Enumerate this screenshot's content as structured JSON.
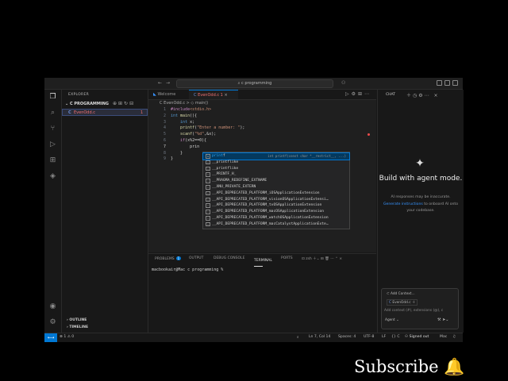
{
  "titlebar": {
    "search": "c programming"
  },
  "explorer": {
    "title": "EXPLORER",
    "folder": "C PROGRAMMING",
    "file_icon": "C",
    "file": "EvenOdd.c",
    "file_badge": "1",
    "sections": [
      "OUTLINE",
      "TIMELINE"
    ]
  },
  "editor": {
    "tabs": [
      {
        "label": "Welcome"
      },
      {
        "label": "EvenOdd.c 1"
      }
    ],
    "breadcrumb": "C EvenOdd.c  >  ◇ main()",
    "lines": [
      {
        "n": "1",
        "html": "<span class='pp'>#include</span><span class='st'>&lt;stdio.h&gt;</span>"
      },
      {
        "n": "2",
        "html": "<span class='kw'>int</span> <span class='fn'>main</span>(){"
      },
      {
        "n": "3",
        "html": "    <span class='kw'>int</span> x;"
      },
      {
        "n": "4",
        "html": "    <span class='fn'>printf</span>(<span class='st'>\"Enter a number: \"</span>);"
      },
      {
        "n": "5",
        "html": "    <span class='fn'>scanf</span>(<span class='st'>\"%d\"</span>,&amp;x);"
      },
      {
        "n": "6",
        "html": "    <span class='pp'>if</span>(x%2==0){"
      },
      {
        "n": "7",
        "html": "        prin"
      },
      {
        "n": "8",
        "html": "    }"
      },
      {
        "n": "9",
        "html": "}"
      }
    ]
  },
  "suggest": {
    "items": [
      {
        "label": "printf",
        "detail": "int printf(const char *__restrict__, ...)"
      },
      {
        "label": "__printflike",
        "detail": ""
      },
      {
        "label": "__printflike",
        "detail": ""
      },
      {
        "label": "__PRINTF_H_",
        "detail": ""
      },
      {
        "label": "__PRAGMA_REDEFINE_EXTNAME",
        "detail": ""
      },
      {
        "label": "__XNU_PRIVATE_EXTERN",
        "detail": ""
      },
      {
        "label": "__API_DEPRECATED_PLATFORM_iOSApplicationExtension",
        "detail": ""
      },
      {
        "label": "__API_DEPRECATED_PLATFORM_visionOSApplicationExtensi…",
        "detail": ""
      },
      {
        "label": "__API_DEPRECATED_PLATFORM_tvOSApplicationExtension",
        "detail": ""
      },
      {
        "label": "__API_DEPRECATED_PLATFORM_macOSApplicationExtension",
        "detail": ""
      },
      {
        "label": "__API_DEPRECATED_PLATFORM_watchOSApplicationExtension",
        "detail": ""
      },
      {
        "label": "__API_DEPRECATED_PLATFORM_macCatalystApplicationExte…",
        "detail": ""
      }
    ]
  },
  "panel": {
    "tabs": [
      "PROBLEMS",
      "OUTPUT",
      "DEBUG CONSOLE",
      "TERMINAL",
      "PORTS"
    ],
    "problems_count": "1",
    "terminal_name": "zsh",
    "prompt": "macbookair@Mac c programming %"
  },
  "chat": {
    "title": "CHAT",
    "heading": "Build with agent mode.",
    "note": "AI responses may be inaccurate.",
    "link": "Generate instructions",
    "link_rest": "to onboard AI onto",
    "line3": "your codebase.",
    "add_context": "Add Context...",
    "context_file": "EvenOdd.c",
    "placeholder": "Add context (#), extensions (@), c",
    "mode": "Agent"
  },
  "status": {
    "errors": "1",
    "warnings": "0",
    "position": "Ln 7, Col 14",
    "spaces": "Spaces: 4",
    "encoding": "UTF-8",
    "eol": "LF",
    "language": "C",
    "signed": "Signed out",
    "platform": "Mac"
  },
  "overlay": {
    "text": "Subscribe 🔔"
  }
}
